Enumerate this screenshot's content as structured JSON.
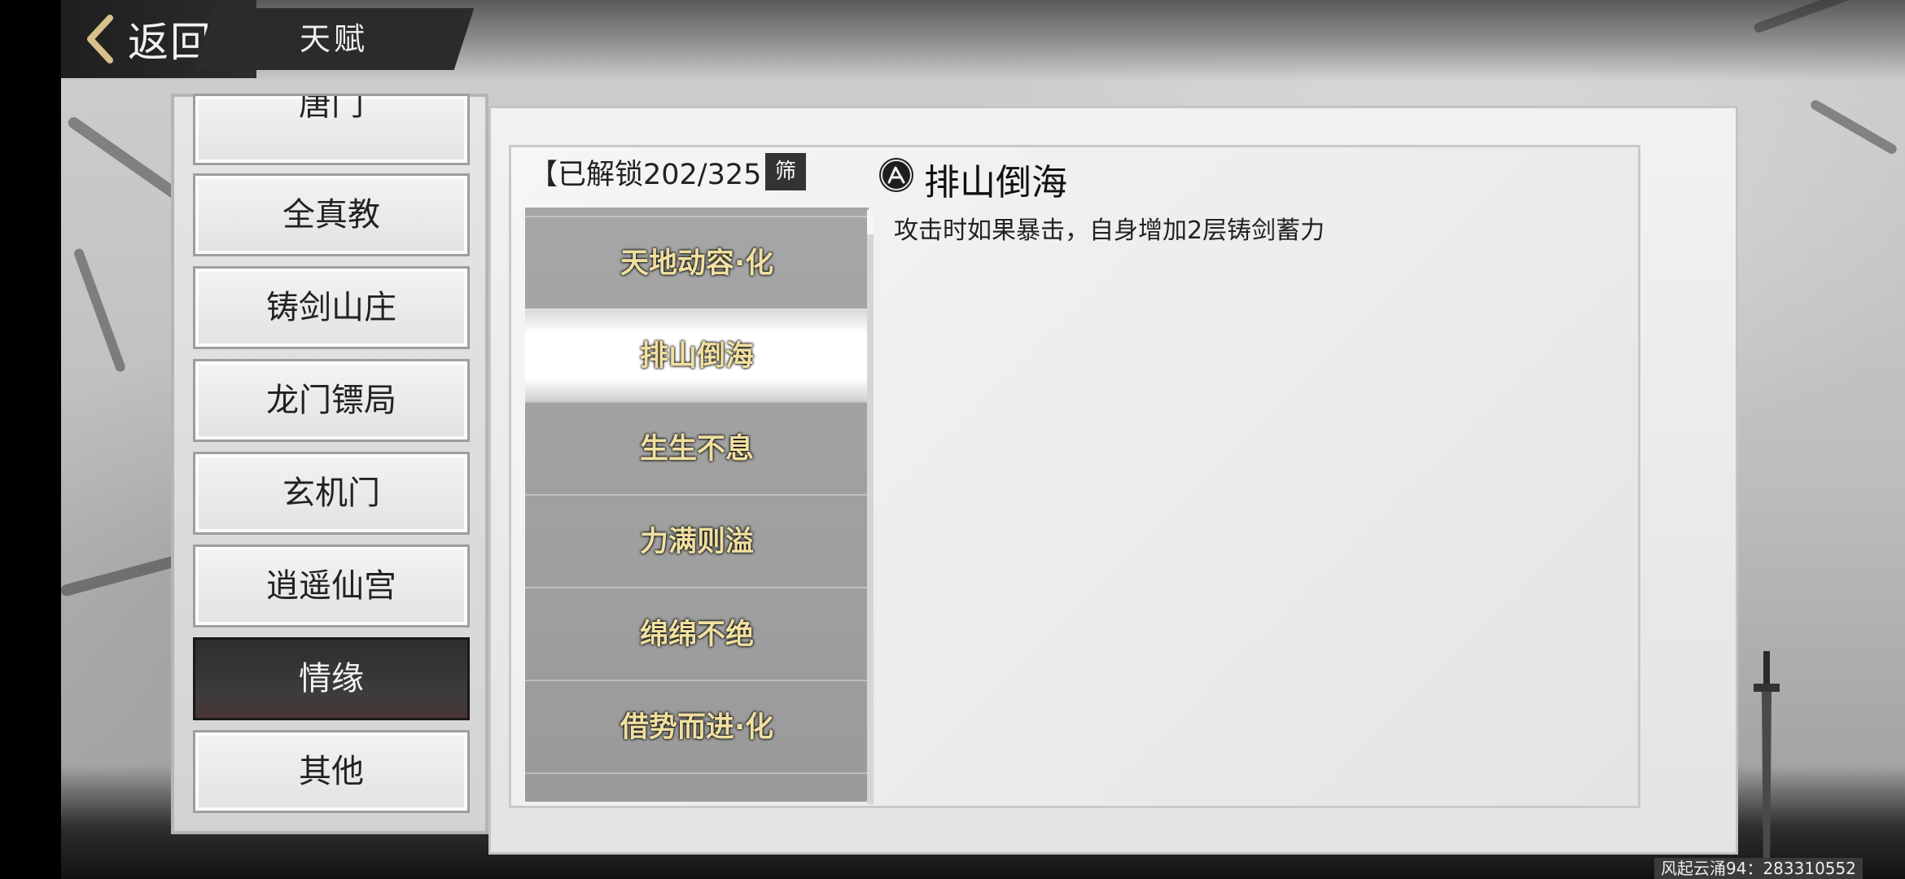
{
  "header": {
    "back_label": "返回",
    "title": "天赋"
  },
  "sidebar": {
    "partial_top": "唐门",
    "items": [
      {
        "label": "全真教"
      },
      {
        "label": "铸剑山庄"
      },
      {
        "label": "龙门镖局"
      },
      {
        "label": "玄机门"
      },
      {
        "label": "逍遥仙宫"
      },
      {
        "label": "情缘",
        "active": true
      },
      {
        "label": "其他"
      }
    ]
  },
  "talents": {
    "unlock_text": "【已解锁202/325",
    "filter_label": "筛",
    "items": [
      {
        "label": "天地动容·化"
      },
      {
        "label": "排山倒海",
        "active": true
      },
      {
        "label": "生生不息"
      },
      {
        "label": "力满则溢"
      },
      {
        "label": "绵绵不绝"
      },
      {
        "label": "借势而进·化"
      }
    ]
  },
  "detail": {
    "icon": "talent-emblem-icon",
    "name": "排山倒海",
    "description": "攻击时如果暴击，自身增加2层铸剑蓄力"
  },
  "watermark": "风起云涌94：283310552",
  "colors": {
    "list_text": "#f0dfa0",
    "active_tab_bg": "#2d2d2d"
  }
}
